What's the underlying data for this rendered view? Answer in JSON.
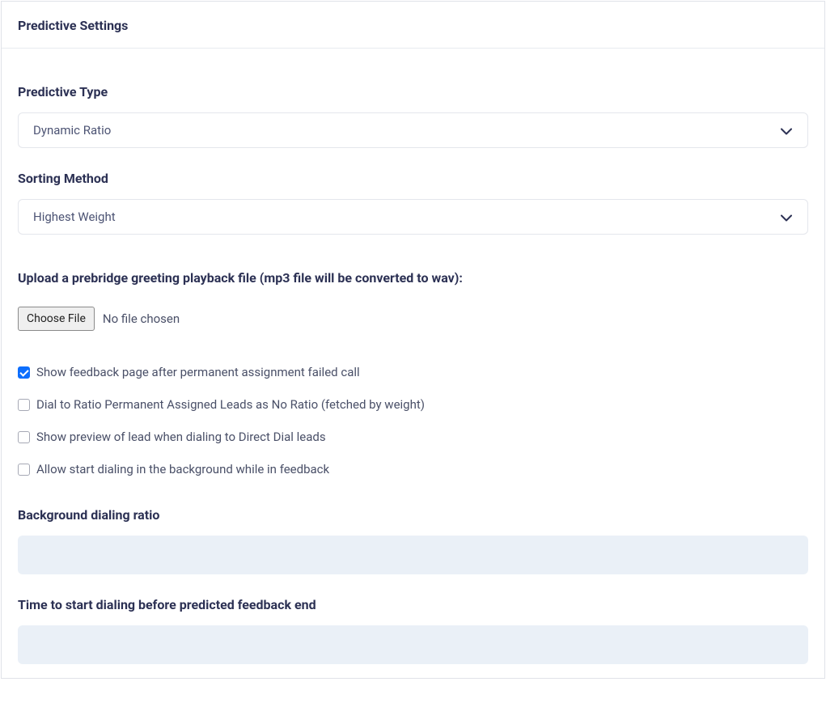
{
  "header": {
    "title": "Predictive Settings"
  },
  "predictiveType": {
    "label": "Predictive Type",
    "selected": "Dynamic Ratio"
  },
  "sortingMethod": {
    "label": "Sorting Method",
    "selected": "Highest Weight"
  },
  "upload": {
    "label": "Upload a prebridge greeting playback file (mp3 file will be converted to wav):",
    "button": "Choose File",
    "status": "No file chosen"
  },
  "checkboxes": [
    {
      "label": "Show feedback page after permanent assignment failed call",
      "checked": true
    },
    {
      "label": "Dial to Ratio Permanent Assigned Leads as No Ratio (fetched by weight)",
      "checked": false
    },
    {
      "label": "Show preview of lead when dialing to Direct Dial leads",
      "checked": false
    },
    {
      "label": "Allow start dialing in the background while in feedback",
      "checked": false
    }
  ],
  "backgroundRatio": {
    "label": "Background dialing ratio",
    "value": ""
  },
  "timeToStart": {
    "label": "Time to start dialing before predicted feedback end",
    "value": ""
  }
}
